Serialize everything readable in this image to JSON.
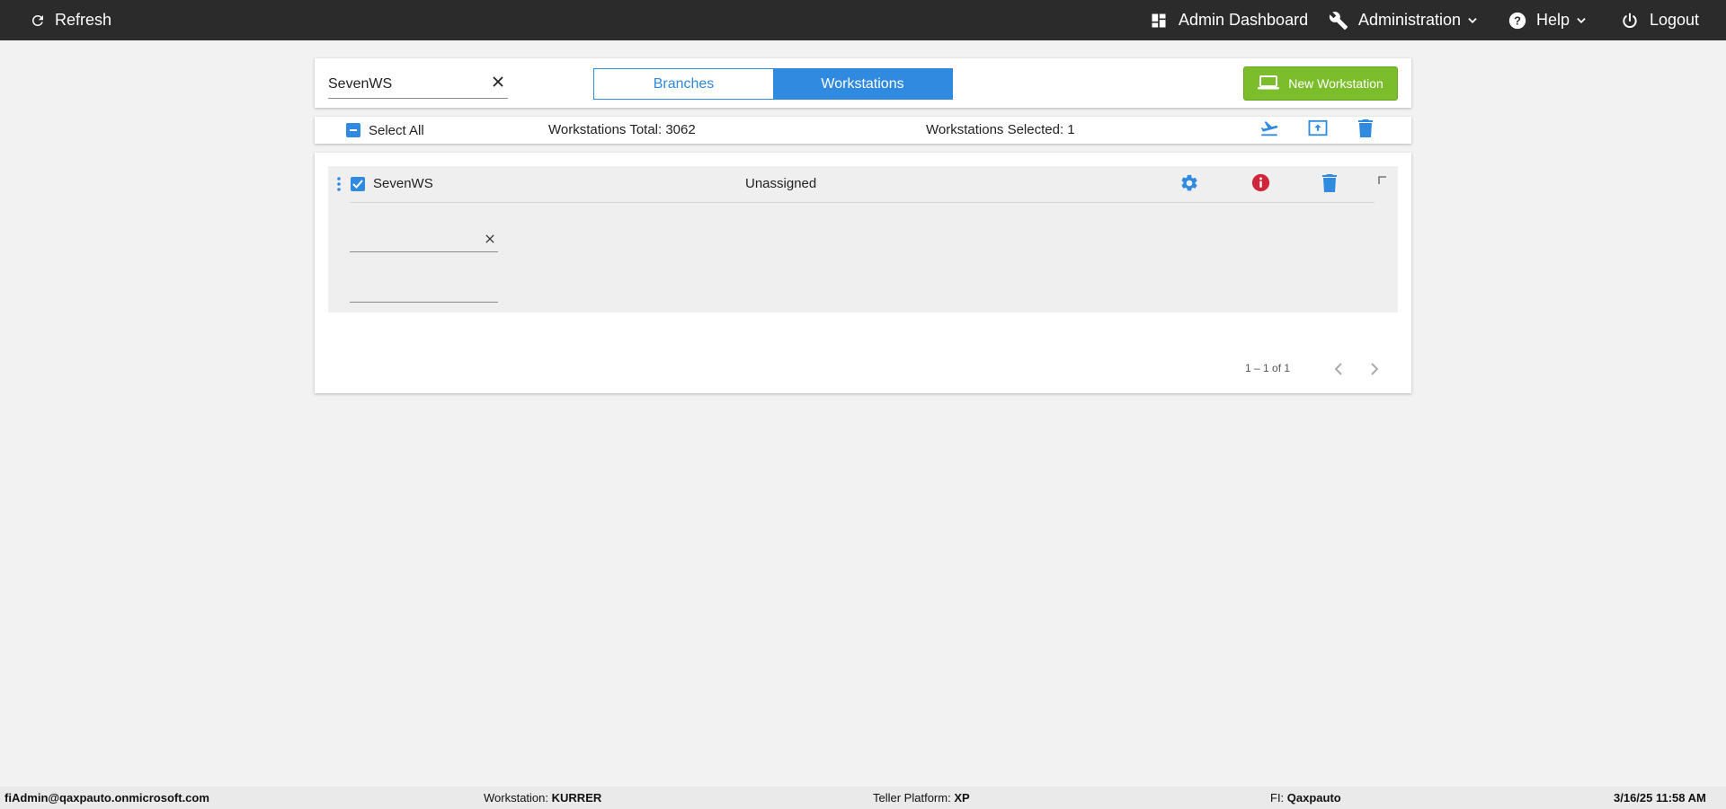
{
  "topbar": {
    "refresh_label": "Refresh",
    "admin_dashboard_label": "Admin Dashboard",
    "administration_label": "Administration",
    "help_label": "Help",
    "logout_label": "Logout"
  },
  "search": {
    "value": "SevenWS",
    "clear_symbol": "×"
  },
  "tabs": [
    {
      "label": "Branches",
      "active": false
    },
    {
      "label": "Workstations",
      "active": true
    }
  ],
  "new_workstation_label": "New Workstation",
  "selection": {
    "select_all_label": "Select All",
    "total_label": "Workstations Total: 3062",
    "selected_label": "Workstations Selected: 1"
  },
  "rows": [
    {
      "name": "SevenWS",
      "status": "Unassigned",
      "checked": true
    }
  ],
  "pager": {
    "range_label": "1 – 1 of 1"
  },
  "footer": {
    "user": "fiAdmin@qaxpauto.onmicrosoft.com",
    "workstation_label": "Workstation:",
    "workstation_value": "KURRER",
    "platform_label": "Teller Platform:",
    "platform_value": "XP",
    "fi_label": "FI:",
    "fi_value": "Qaxpauto",
    "datetime": "3/16/25 11:58 AM"
  },
  "colors": {
    "topbar_bg": "#2b2b2b",
    "accent_blue": "#2f8ae0",
    "new_button_green": "#7cbd2b",
    "info_red": "#d0263b",
    "page_bg": "#f2f2f2"
  },
  "icons": {
    "refresh": "refresh-icon",
    "dashboard": "dashboard-icon",
    "administration": "wrench-icon",
    "help": "help-circle-icon",
    "logout": "power-icon",
    "new_workstation": "laptop-icon",
    "deploy": "airplane-takeoff-icon",
    "upload": "upload-box-icon",
    "delete": "trash-icon",
    "settings": "gear-icon",
    "info": "info-icon",
    "drag": "drag-handle-icon"
  }
}
